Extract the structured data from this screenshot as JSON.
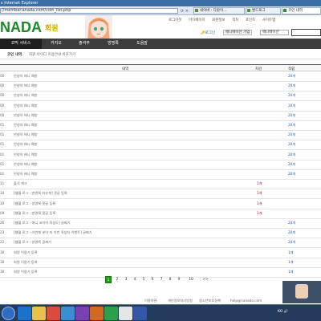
{
  "browser": {
    "title": "s Internet Explorer",
    "address": "//member.anada.com/coin_list.php",
    "tabs": [
      "네이버 : 다같이...",
      "밴드로그",
      "코인 내역"
    ]
  },
  "header": {
    "logo": "NADA",
    "logo_sub": "회원",
    "top_links": [
      "로그아웃",
      "마이페이지",
      "회원정보",
      "쪽지",
      "포인트",
      "사이트맵"
    ],
    "login": "로그인",
    "signup": "애니메이션 가입",
    "select": "애니메이션"
  },
  "mainnav": [
    "코믹 서비스",
    "카지오",
    "출석부",
    "방명록",
    "도움말"
  ],
  "subnav": [
    "코인 내역",
    "회원 아이디 이용안내 바로가기"
  ],
  "list_head": {
    "content": "내역",
    "dec": "차감",
    "inc": "적립"
  },
  "rows": [
    {
      "num": "00",
      "text": "안녕의 애니 예방",
      "dec": "",
      "inc": "20개"
    },
    {
      "num": "00",
      "text": "안녕의 애니 예방",
      "dec": "",
      "inc": "20개"
    },
    {
      "num": "00",
      "text": "안녕의 애니 예방",
      "dec": "",
      "inc": "20개"
    },
    {
      "num": "00",
      "text": "안녕의 애니 예방",
      "dec": "",
      "inc": "20개"
    },
    {
      "num": "00",
      "text": "안녕의 애니 예방",
      "dec": "",
      "inc": "20개"
    },
    {
      "num": "01",
      "text": "안녕의 애니 예방",
      "dec": "",
      "inc": "20개"
    },
    {
      "num": "01",
      "text": "안녕의 애니 예방",
      "dec": "",
      "inc": "20개"
    },
    {
      "num": "01",
      "text": "안녕의 애니 예방",
      "dec": "",
      "inc": "20개"
    },
    {
      "num": "01",
      "text": "안녕의 애니 예방",
      "dec": "",
      "inc": "20개"
    },
    {
      "num": "01",
      "text": "안녕의 애니 예방",
      "dec": "",
      "inc": "20개"
    },
    {
      "num": "01",
      "text": "안녕의 애니 예방",
      "dec": "",
      "inc": "20개"
    },
    {
      "num": "11",
      "text": "출석 체크",
      "dec": "1개",
      "inc": ""
    },
    {
      "num": "10",
      "text": "[웹월 로그 - 방명록 자유게] 댓글 등록",
      "dec": "1개",
      "inc": ""
    },
    {
      "num": "10",
      "text": "[웹월 로그 - 방명록 댓글 등록",
      "dec": "1개",
      "inc": ""
    },
    {
      "num": "09",
      "text": "[웹월 로그 - 방명록 댓글 등록",
      "dec": "1개",
      "inc": ""
    },
    {
      "num": "26",
      "text": "[웹월 로그 - 애니 코미의 육성도] 골짜기",
      "dec": "",
      "inc": "20개"
    },
    {
      "num": "23",
      "text": "[웹월 로그 - 이번에 넣어 자 이번 육성자 이벤트] 골짜기",
      "dec": "",
      "inc": "20개"
    },
    {
      "num": "22",
      "text": "[웹월 로그 - 방명록 골짜기",
      "dec": "",
      "inc": "20개"
    },
    {
      "num": "18",
      "text": "회원 이용기 등록",
      "dec": "",
      "inc": "1개"
    },
    {
      "num": "18",
      "text": "회원 이용기 등록",
      "dec": "",
      "inc": "1개"
    },
    {
      "num": "18",
      "text": "회원 이용기 등록",
      "dec": "",
      "inc": "1개"
    }
  ],
  "pager": {
    "pages": [
      "1",
      "2",
      "3",
      "4",
      "5",
      "6",
      "7",
      "8",
      "9",
      "10"
    ],
    "current": "1",
    "next": ">>"
  },
  "footer": [
    "이용약관",
    "개인정보처리방침",
    "청소년보호정책",
    "help@nanada.com"
  ],
  "tray": {
    "lang": "KO"
  }
}
